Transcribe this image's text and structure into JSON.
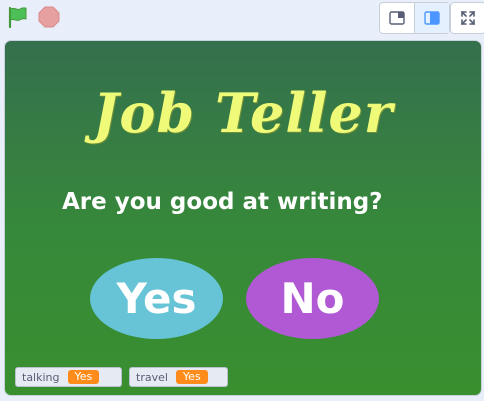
{
  "toolbar": {
    "flag_icon": "green-flag-icon",
    "stop_icon": "stop-icon",
    "small_stage_icon": "small-stage-icon",
    "large_stage_icon": "large-stage-icon",
    "fullscreen_icon": "fullscreen-icon"
  },
  "stage": {
    "title": "Job Teller",
    "question": "Are you good at writing?",
    "yes_label": "Yes",
    "no_label": "No"
  },
  "monitors": [
    {
      "name": "talking",
      "value": "Yes"
    },
    {
      "name": "travel",
      "value": "Yes"
    }
  ],
  "colors": {
    "title": "#eefa78",
    "yes_button": "#66c4d6",
    "no_button": "#b159d4",
    "monitor_value": "#ff8c1a",
    "stage_top": "#35704d",
    "stage_bottom": "#398f2e"
  }
}
